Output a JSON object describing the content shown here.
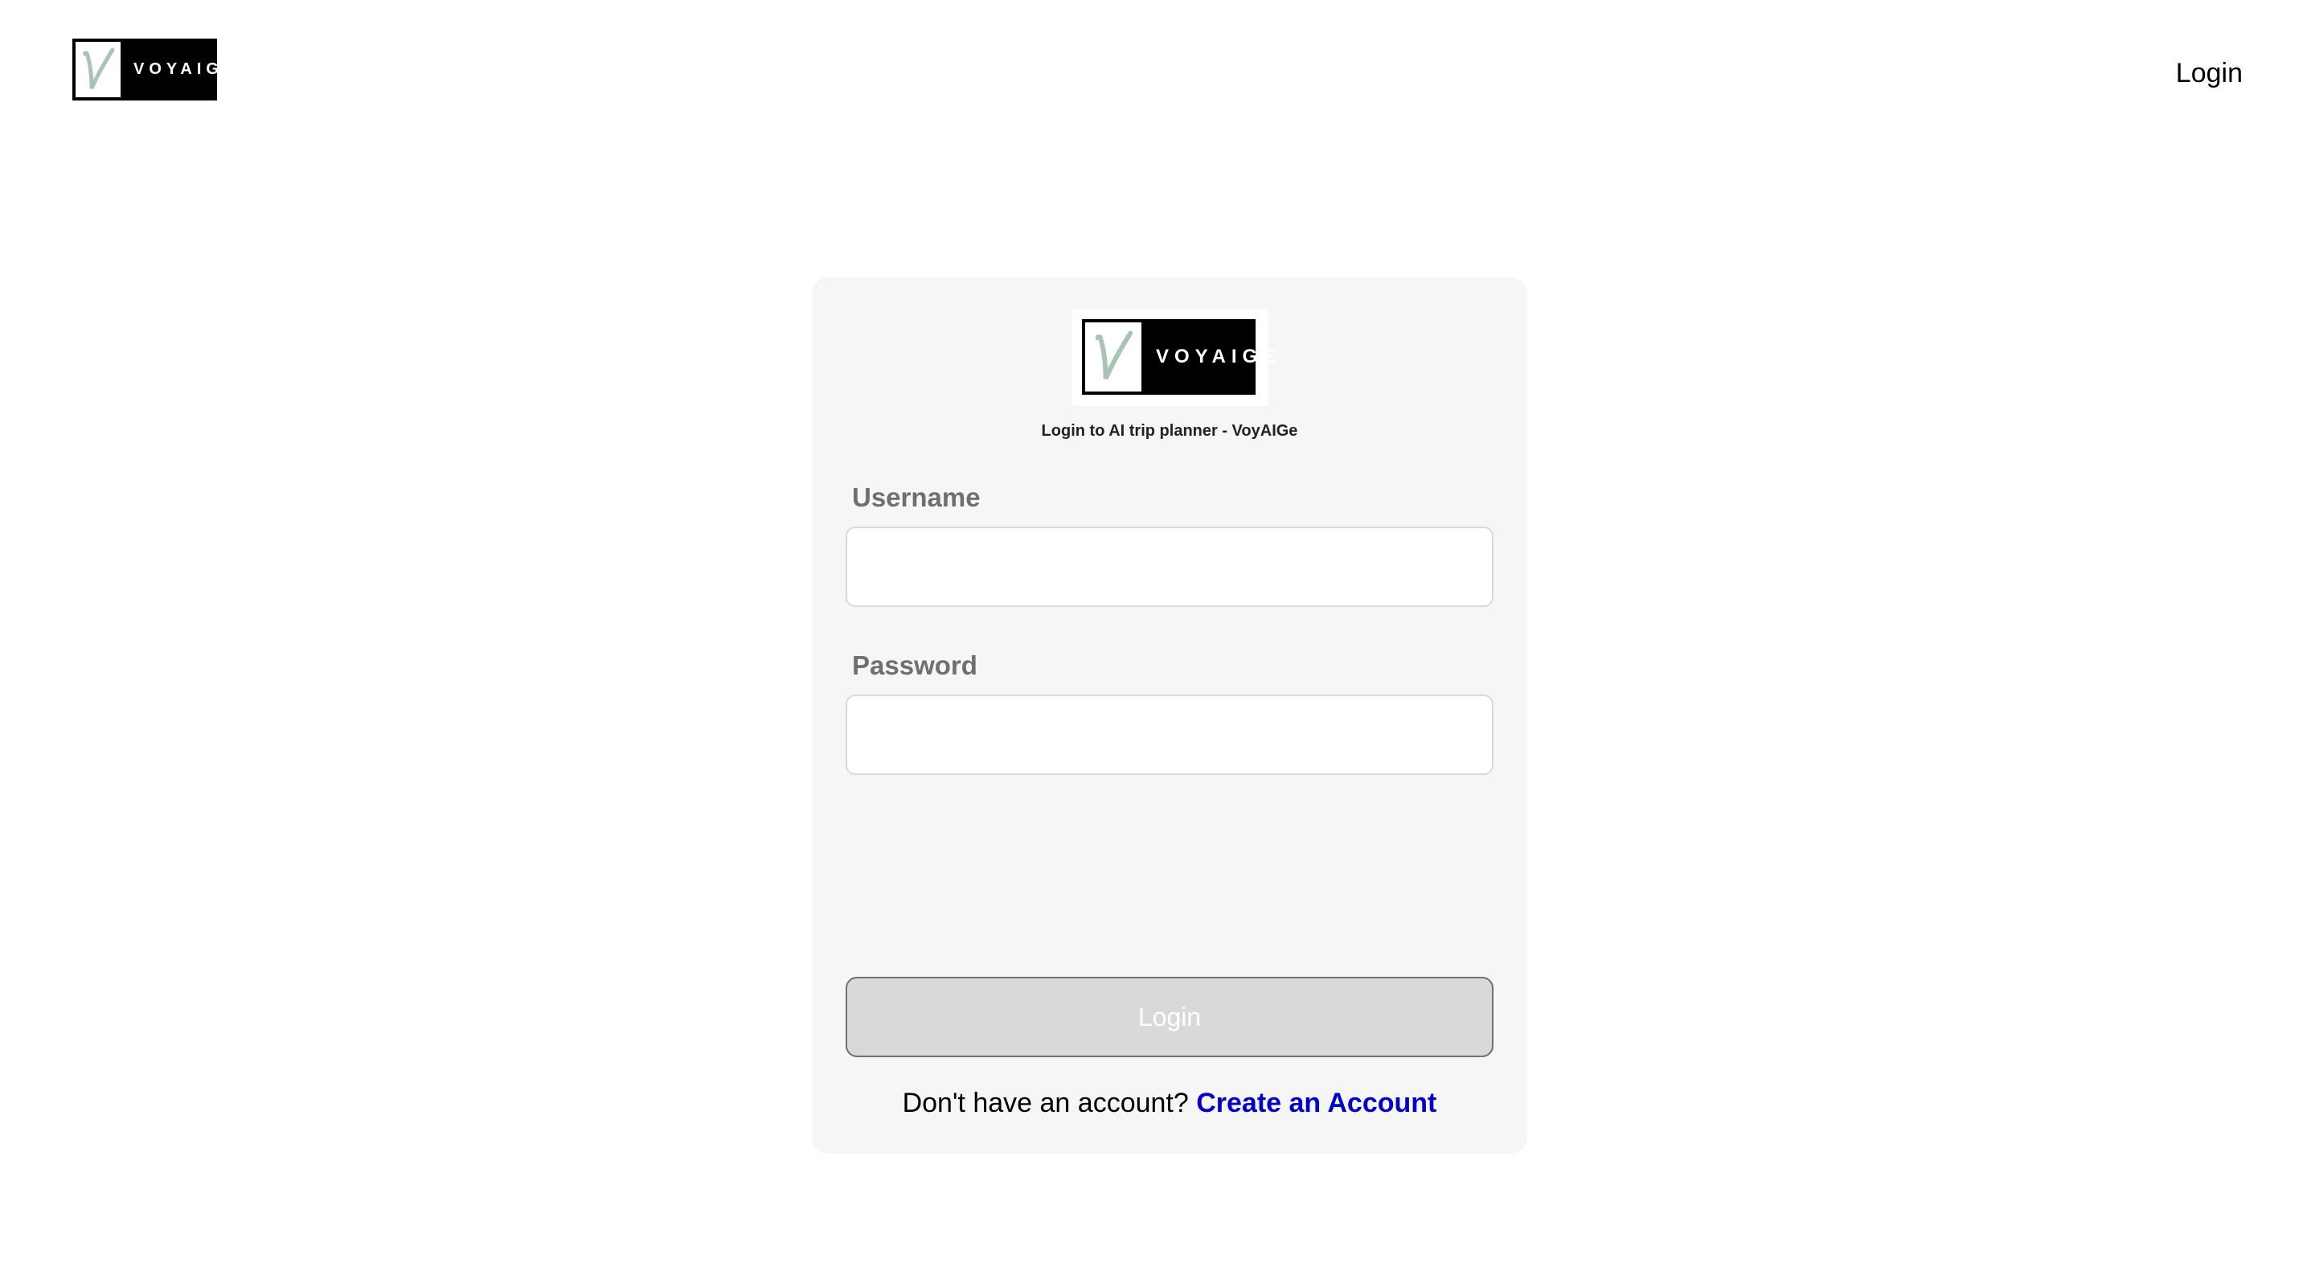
{
  "header": {
    "logo": {
      "mark": "V",
      "word": "VOYAIGE"
    },
    "nav_login_label": "Login"
  },
  "card": {
    "logo": {
      "mark": "V",
      "word": "VOYAIGE"
    },
    "subtitle": "Login to AI trip planner - VoyAIGe",
    "username": {
      "label": "Username",
      "value": "",
      "placeholder": ""
    },
    "password": {
      "label": "Password",
      "value": "",
      "placeholder": ""
    },
    "login_button_label": "Login",
    "signup_prompt": "Don't have an account?",
    "signup_link_label": "Create an Account"
  },
  "colors": {
    "page_background": "#ffffff",
    "card_background": "#f6f6f6",
    "label_text": "#6f6f6f",
    "button_background": "#d9d9d9",
    "button_text": "#ffffff",
    "link": "#0000cc",
    "logo_mark": "#a9c3b5"
  },
  "icons": {
    "logo_mark": "script-v-logo-icon"
  }
}
